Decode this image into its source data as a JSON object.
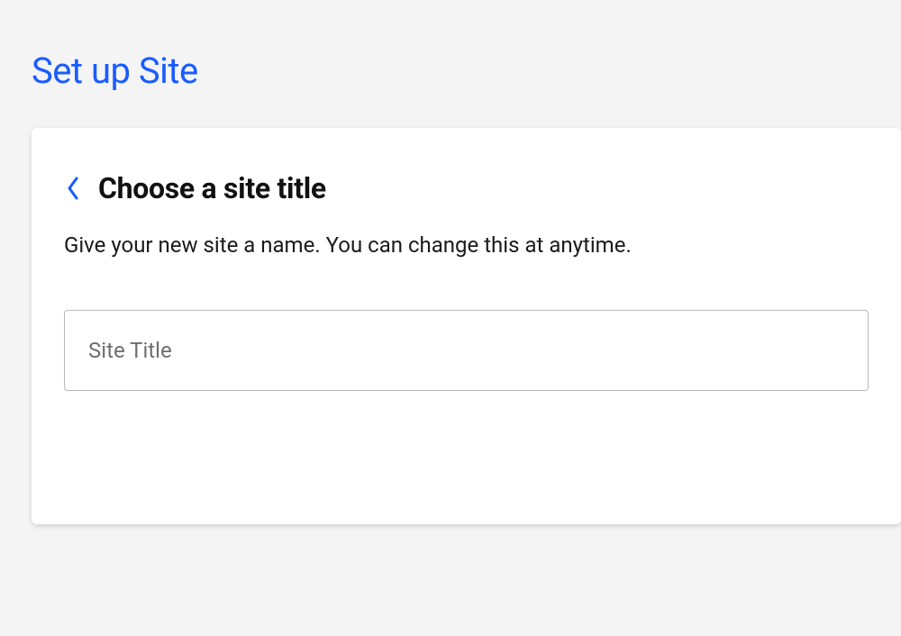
{
  "page": {
    "title": "Set up Site"
  },
  "card": {
    "heading": "Choose a site title",
    "subtext": "Give your new site a name. You can change this at anytime.",
    "input": {
      "value": "",
      "placeholder": "Site Title"
    }
  },
  "colors": {
    "accent": "#1a5cff",
    "background": "#f4f4f4",
    "card_bg": "#ffffff",
    "border": "#b8b8b8"
  }
}
